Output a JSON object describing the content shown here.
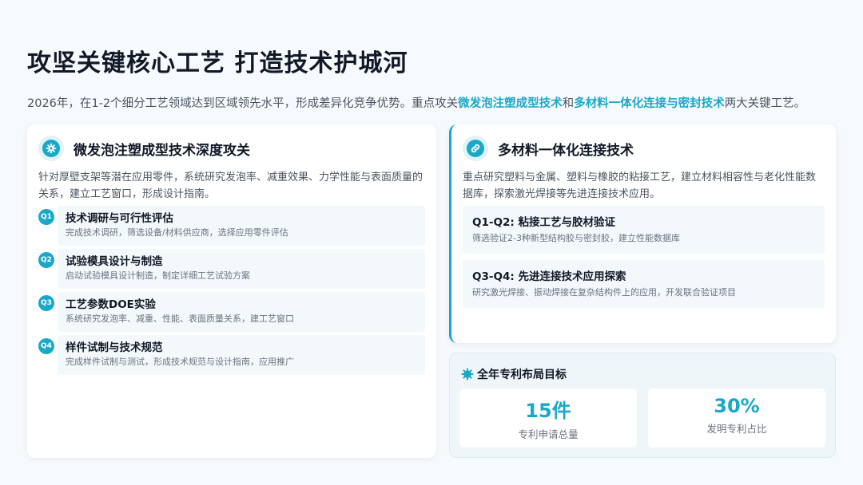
{
  "header": {
    "title": "攻坚关键核心工艺  打造技术护城河",
    "subtitle_pre": "2026年，在1-2个细分工艺领域达到区域领先水平，形成差异化竞争优势。重点攻关",
    "subtitle_hl1": "微发泡注塑成型技术",
    "subtitle_mid": "和",
    "subtitle_hl2": "多材料一体化连接与密封技术",
    "subtitle_post": "两大关键工艺。"
  },
  "left_card": {
    "icon": "gear-icon",
    "title": "微发泡注塑成型技术深度攻关",
    "desc": "针对厚壁支架等潜在应用零件，系统研究发泡率、减重效果、力学性能与表面质量的关系，建立工艺窗口，形成设计指南。",
    "items": [
      {
        "badge": "Q1",
        "title": "技术调研与可行性评估",
        "sub": "完成技术调研，筛选设备/材料供应商，选择应用零件评估"
      },
      {
        "badge": "Q2",
        "title": "试验模具设计与制造",
        "sub": "启动试验模具设计制造，制定详细工艺试验方案"
      },
      {
        "badge": "Q3",
        "title": "工艺参数DOE实验",
        "sub": "系统研究发泡率、减重、性能、表面质量关系，建工艺窗口"
      },
      {
        "badge": "Q4",
        "title": "样件试制与技术规范",
        "sub": "完成样件试制与测试，形成技术规范与设计指南，应用推广"
      }
    ]
  },
  "right_card": {
    "icon": "link-icon",
    "title": "多材料一体化连接技术",
    "desc": "重点研究塑料与金属、塑料与橡胶的粘接工艺，建立材料相容性与老化性能数据库，探索激光焊接等先进连接技术应用。",
    "items": [
      {
        "title": "Q1-Q2: 粘接工艺与胶材验证",
        "sub": "筛选验证2-3种新型结构胶与密封胶，建立性能数据库"
      },
      {
        "title": "Q3-Q4: 先进连接技术应用探索",
        "sub": "研究激光焊接、振动焊接在复杂结构件上的应用，开发联合验证项目"
      }
    ]
  },
  "patent": {
    "icon": "badge-icon",
    "title": "全年专利布局目标",
    "stats": [
      {
        "value": "15件",
        "label": "专利申请总量"
      },
      {
        "value": "30%",
        "label": "发明专利占比"
      }
    ]
  },
  "colors": {
    "accent": "#1aa8c9",
    "text": "#111827",
    "muted": "#6b7280"
  }
}
